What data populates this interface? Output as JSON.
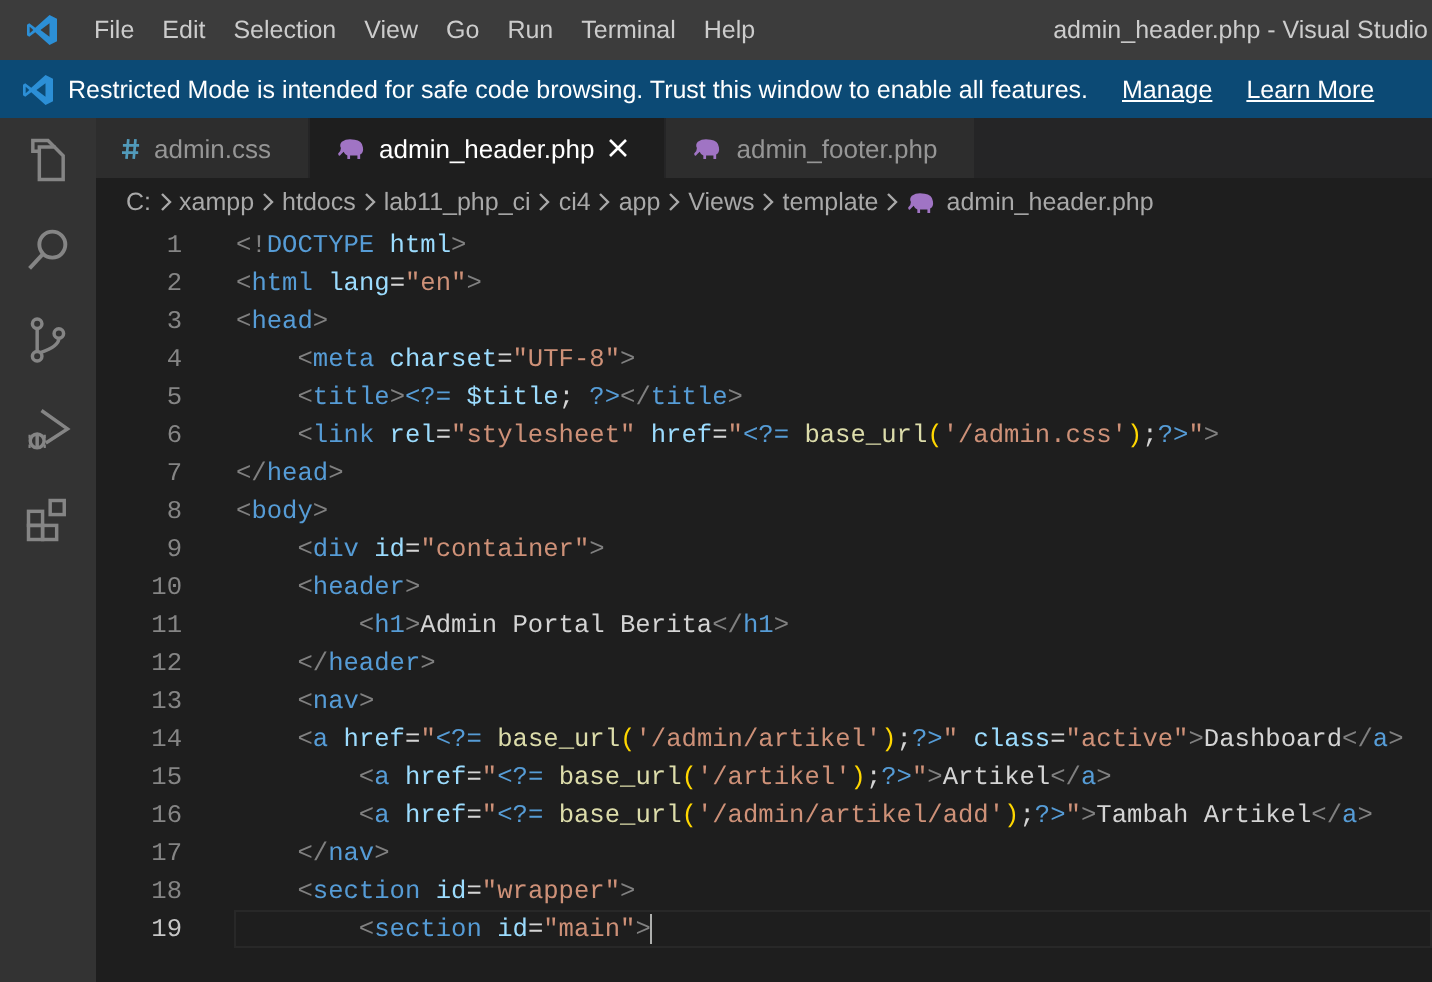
{
  "window": {
    "title": "admin_header.php - Visual Studio"
  },
  "menu": [
    "File",
    "Edit",
    "Selection",
    "View",
    "Go",
    "Run",
    "Terminal",
    "Help"
  ],
  "banner": {
    "message": "Restricted Mode is intended for safe code browsing. Trust this window to enable all features.",
    "links": [
      "Manage",
      "Learn More"
    ]
  },
  "activity_bar": [
    {
      "kind": "files"
    },
    {
      "kind": "search"
    },
    {
      "kind": "source-control"
    },
    {
      "kind": "run-debug"
    },
    {
      "kind": "extensions"
    }
  ],
  "tabs": [
    {
      "label": "admin.css",
      "kind": "css",
      "selected": false
    },
    {
      "label": "admin_header.php",
      "kind": "php",
      "selected": true
    },
    {
      "label": "admin_footer.php",
      "kind": "php",
      "selected": false
    }
  ],
  "breadcrumb": [
    {
      "label": "C:"
    },
    {
      "label": "xampp"
    },
    {
      "label": "htdocs"
    },
    {
      "label": "lab11_php_ci"
    },
    {
      "label": "ci4"
    },
    {
      "label": "app"
    },
    {
      "label": "Views"
    },
    {
      "label": "template"
    },
    {
      "label": "admin_header.php",
      "kind": "php"
    }
  ],
  "lines": [
    {
      "number": "1",
      "current": false,
      "tokens": [
        {
          "kind": "punct",
          "text": "<!"
        },
        {
          "kind": "tag",
          "text": "DOCTYPE"
        },
        {
          "kind": "attr",
          "text": " html"
        },
        {
          "kind": "punct",
          "text": ">"
        }
      ]
    },
    {
      "number": "2",
      "current": false,
      "tokens": [
        {
          "kind": "punct",
          "text": "<"
        },
        {
          "kind": "tag",
          "text": "html"
        },
        {
          "kind": "attr",
          "text": " lang"
        },
        {
          "kind": "text",
          "text": "="
        },
        {
          "kind": "str",
          "text": "\"en\""
        },
        {
          "kind": "punct",
          "text": ">"
        }
      ]
    },
    {
      "number": "3",
      "current": false,
      "tokens": [
        {
          "kind": "punct",
          "text": "<"
        },
        {
          "kind": "tag",
          "text": "head"
        },
        {
          "kind": "punct",
          "text": ">"
        }
      ]
    },
    {
      "number": "4",
      "current": false,
      "tokens": [
        {
          "kind": "punct",
          "text": "    <"
        },
        {
          "kind": "tag",
          "text": "meta"
        },
        {
          "kind": "attr",
          "text": " charset"
        },
        {
          "kind": "text",
          "text": "="
        },
        {
          "kind": "str",
          "text": "\"UTF-8\""
        },
        {
          "kind": "punct",
          "text": ">"
        }
      ]
    },
    {
      "number": "5",
      "current": false,
      "tokens": [
        {
          "kind": "punct",
          "text": "    <"
        },
        {
          "kind": "tag",
          "text": "title"
        },
        {
          "kind": "punct",
          "text": ">"
        },
        {
          "kind": "php",
          "text": "<?="
        },
        {
          "kind": "var",
          "text": " $title"
        },
        {
          "kind": "text",
          "text": "; "
        },
        {
          "kind": "php",
          "text": "?>"
        },
        {
          "kind": "punct",
          "text": "</"
        },
        {
          "kind": "tag",
          "text": "title"
        },
        {
          "kind": "punct",
          "text": ">"
        }
      ]
    },
    {
      "number": "6",
      "current": false,
      "tokens": [
        {
          "kind": "punct",
          "text": "    <"
        },
        {
          "kind": "tag",
          "text": "link"
        },
        {
          "kind": "attr",
          "text": " rel"
        },
        {
          "kind": "text",
          "text": "="
        },
        {
          "kind": "str",
          "text": "\"stylesheet\""
        },
        {
          "kind": "attr",
          "text": " href"
        },
        {
          "kind": "text",
          "text": "="
        },
        {
          "kind": "str",
          "text": "\""
        },
        {
          "kind": "php",
          "text": "<?="
        },
        {
          "kind": "func",
          "text": " base_url"
        },
        {
          "kind": "paren",
          "text": "("
        },
        {
          "kind": "str",
          "text": "'/admin.css'"
        },
        {
          "kind": "paren",
          "text": ")"
        },
        {
          "kind": "text",
          "text": ";"
        },
        {
          "kind": "php",
          "text": "?>"
        },
        {
          "kind": "str",
          "text": "\""
        },
        {
          "kind": "punct",
          "text": ">"
        }
      ]
    },
    {
      "number": "7",
      "current": false,
      "tokens": [
        {
          "kind": "punct",
          "text": "</"
        },
        {
          "kind": "tag",
          "text": "head"
        },
        {
          "kind": "punct",
          "text": ">"
        }
      ]
    },
    {
      "number": "8",
      "current": false,
      "tokens": [
        {
          "kind": "punct",
          "text": "<"
        },
        {
          "kind": "tag",
          "text": "body"
        },
        {
          "kind": "punct",
          "text": ">"
        }
      ]
    },
    {
      "number": "9",
      "current": false,
      "tokens": [
        {
          "kind": "punct",
          "text": "    <"
        },
        {
          "kind": "tag",
          "text": "div"
        },
        {
          "kind": "attr",
          "text": " id"
        },
        {
          "kind": "text",
          "text": "="
        },
        {
          "kind": "str",
          "text": "\"container\""
        },
        {
          "kind": "punct",
          "text": ">"
        }
      ]
    },
    {
      "number": "10",
      "current": false,
      "tokens": [
        {
          "kind": "punct",
          "text": "    <"
        },
        {
          "kind": "tag",
          "text": "header"
        },
        {
          "kind": "punct",
          "text": ">"
        }
      ]
    },
    {
      "number": "11",
      "current": false,
      "tokens": [
        {
          "kind": "punct",
          "text": "        <"
        },
        {
          "kind": "tag",
          "text": "h1"
        },
        {
          "kind": "punct",
          "text": ">"
        },
        {
          "kind": "text",
          "text": "Admin Portal Berita"
        },
        {
          "kind": "punct",
          "text": "</"
        },
        {
          "kind": "tag",
          "text": "h1"
        },
        {
          "kind": "punct",
          "text": ">"
        }
      ]
    },
    {
      "number": "12",
      "current": false,
      "tokens": [
        {
          "kind": "punct",
          "text": "    </"
        },
        {
          "kind": "tag",
          "text": "header"
        },
        {
          "kind": "punct",
          "text": ">"
        }
      ]
    },
    {
      "number": "13",
      "current": false,
      "tokens": [
        {
          "kind": "punct",
          "text": "    <"
        },
        {
          "kind": "tag",
          "text": "nav"
        },
        {
          "kind": "punct",
          "text": ">"
        }
      ]
    },
    {
      "number": "14",
      "current": false,
      "tokens": [
        {
          "kind": "punct",
          "text": "    <"
        },
        {
          "kind": "tag",
          "text": "a"
        },
        {
          "kind": "attr",
          "text": " href"
        },
        {
          "kind": "text",
          "text": "="
        },
        {
          "kind": "str",
          "text": "\""
        },
        {
          "kind": "php",
          "text": "<?="
        },
        {
          "kind": "func",
          "text": " base_url"
        },
        {
          "kind": "paren",
          "text": "("
        },
        {
          "kind": "str",
          "text": "'/admin/artikel'"
        },
        {
          "kind": "paren",
          "text": ")"
        },
        {
          "kind": "text",
          "text": ";"
        },
        {
          "kind": "php",
          "text": "?>"
        },
        {
          "kind": "str",
          "text": "\""
        },
        {
          "kind": "attr",
          "text": " class"
        },
        {
          "kind": "text",
          "text": "="
        },
        {
          "kind": "str",
          "text": "\"active\""
        },
        {
          "kind": "punct",
          "text": ">"
        },
        {
          "kind": "text",
          "text": "Dashboard"
        },
        {
          "kind": "punct",
          "text": "</"
        },
        {
          "kind": "tag",
          "text": "a"
        },
        {
          "kind": "punct",
          "text": ">"
        }
      ]
    },
    {
      "number": "15",
      "current": false,
      "tokens": [
        {
          "kind": "punct",
          "text": "        <"
        },
        {
          "kind": "tag",
          "text": "a"
        },
        {
          "kind": "attr",
          "text": " href"
        },
        {
          "kind": "text",
          "text": "="
        },
        {
          "kind": "str",
          "text": "\""
        },
        {
          "kind": "php",
          "text": "<?="
        },
        {
          "kind": "func",
          "text": " base_url"
        },
        {
          "kind": "paren",
          "text": "("
        },
        {
          "kind": "str",
          "text": "'/artikel'"
        },
        {
          "kind": "paren",
          "text": ")"
        },
        {
          "kind": "text",
          "text": ";"
        },
        {
          "kind": "php",
          "text": "?>"
        },
        {
          "kind": "str",
          "text": "\""
        },
        {
          "kind": "punct",
          "text": ">"
        },
        {
          "kind": "text",
          "text": "Artikel"
        },
        {
          "kind": "punct",
          "text": "</"
        },
        {
          "kind": "tag",
          "text": "a"
        },
        {
          "kind": "punct",
          "text": ">"
        }
      ]
    },
    {
      "number": "16",
      "current": false,
      "tokens": [
        {
          "kind": "punct",
          "text": "        <"
        },
        {
          "kind": "tag",
          "text": "a"
        },
        {
          "kind": "attr",
          "text": " href"
        },
        {
          "kind": "text",
          "text": "="
        },
        {
          "kind": "str",
          "text": "\""
        },
        {
          "kind": "php",
          "text": "<?="
        },
        {
          "kind": "func",
          "text": " base_url"
        },
        {
          "kind": "paren",
          "text": "("
        },
        {
          "kind": "str",
          "text": "'/admin/artikel/add'"
        },
        {
          "kind": "paren",
          "text": ")"
        },
        {
          "kind": "text",
          "text": ";"
        },
        {
          "kind": "php",
          "text": "?>"
        },
        {
          "kind": "str",
          "text": "\""
        },
        {
          "kind": "punct",
          "text": ">"
        },
        {
          "kind": "text",
          "text": "Tambah Artikel"
        },
        {
          "kind": "punct",
          "text": "</"
        },
        {
          "kind": "tag",
          "text": "a"
        },
        {
          "kind": "punct",
          "text": ">"
        }
      ]
    },
    {
      "number": "17",
      "current": false,
      "tokens": [
        {
          "kind": "punct",
          "text": "    </"
        },
        {
          "kind": "tag",
          "text": "nav"
        },
        {
          "kind": "punct",
          "text": ">"
        }
      ]
    },
    {
      "number": "18",
      "current": false,
      "tokens": [
        {
          "kind": "punct",
          "text": "    <"
        },
        {
          "kind": "tag",
          "text": "section"
        },
        {
          "kind": "attr",
          "text": " id"
        },
        {
          "kind": "text",
          "text": "="
        },
        {
          "kind": "str",
          "text": "\"wrapper\""
        },
        {
          "kind": "punct",
          "text": ">"
        }
      ]
    },
    {
      "number": "19",
      "current": true,
      "tokens": [
        {
          "kind": "punct",
          "text": "        <"
        },
        {
          "kind": "tag",
          "text": "section"
        },
        {
          "kind": "attr",
          "text": " id"
        },
        {
          "kind": "text",
          "text": "="
        },
        {
          "kind": "str",
          "text": "\"main\""
        },
        {
          "kind": "punct",
          "text": ">"
        }
      ]
    }
  ]
}
